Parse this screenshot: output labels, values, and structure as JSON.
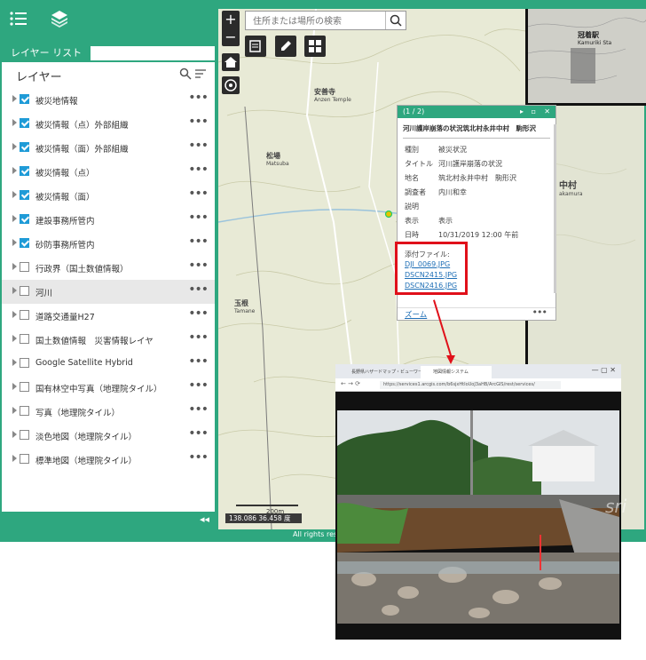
{
  "sidebar": {
    "tab_label": "レイヤー リスト",
    "header": "レイヤー",
    "layers": [
      {
        "label": "被災地情報",
        "checked": true
      },
      {
        "label": "被災情報（点）外部組織",
        "checked": true
      },
      {
        "label": "被災情報（面）外部組織",
        "checked": true
      },
      {
        "label": "被災情報（点）",
        "checked": true
      },
      {
        "label": "被災情報（面）",
        "checked": true
      },
      {
        "label": "建設事務所管内",
        "checked": true
      },
      {
        "label": "砂防事務所管内",
        "checked": true
      },
      {
        "label": "行政界（国土数値情報）",
        "checked": false
      },
      {
        "label": "河川",
        "checked": false,
        "selected": true
      },
      {
        "label": "道路交通量H27",
        "checked": false
      },
      {
        "label": "国土数値情報　災害情報レイヤ",
        "checked": false
      },
      {
        "label": "Google Satellite Hybrid",
        "checked": false
      },
      {
        "label": "国有林空中写真（地理院タイル）",
        "checked": false
      },
      {
        "label": "写真（地理院タイル）",
        "checked": false
      },
      {
        "label": "淡色地図（地理院タイル）",
        "checked": false
      },
      {
        "label": "標準地図（地理院タイル）",
        "checked": false
      }
    ],
    "more_label": "•••",
    "collapse_label": "◂◂"
  },
  "map": {
    "search_placeholder": "住所または場所の検索",
    "zoom_in": "+",
    "zoom_out": "−",
    "labels": {
      "anzenji": "安善寺",
      "anzenji_roman": "Anzen Temple",
      "matsuba": "松場",
      "matsuba_roman": "Matsuba",
      "tamane": "玉根",
      "tamane_roman": "Tamane",
      "village": "中村",
      "village_roman": "akamura",
      "station": "冠着駅",
      "station_roman": "Kamuriki Sta"
    },
    "scale_label": "200m",
    "coords": "138.086 36.458 度",
    "rights": "All rights rese"
  },
  "popup": {
    "counter": "(1 / 2)",
    "title": "河川護岸崩落の状況筑北村永井中村　駒形沢",
    "attributes": [
      {
        "key": "種別",
        "value": "被災状況"
      },
      {
        "key": "タイトル",
        "value": "河川護岸崩落の状況"
      },
      {
        "key": "地名",
        "value": "筑北村永井中村　駒形沢"
      },
      {
        "key": "調査者",
        "value": "内川和幸"
      },
      {
        "key": "説明",
        "value": ""
      },
      {
        "key": "表示",
        "value": "表示"
      },
      {
        "key": "日時",
        "value": "10/31/2019 12:00 午前"
      }
    ],
    "attachments_label": "添付ファイル:",
    "attachments": [
      "DJI_0069.JPG",
      "DSCN2415.JPG",
      "DSCN2416.JPG"
    ],
    "zoom_label": "ズーム",
    "more_label": "•••"
  },
  "browser": {
    "tab1": "長野県ハザードマップ・ビューワー",
    "tab2": "地図情報システム",
    "url": "https://services1.arcgis.com/b6sjxHtIoUoJ3aHB/ArcGIS/rest/services/",
    "watermark": "sri"
  },
  "colors": {
    "accent": "#2ea77f",
    "checkbox": "#1f9bd7",
    "highlight": "#e0101a",
    "link": "#1f6fb6"
  }
}
